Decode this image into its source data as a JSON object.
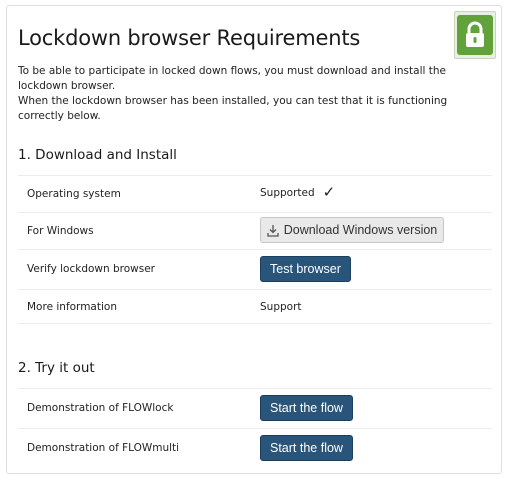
{
  "header": {
    "title": "Lockdown browser Requirements",
    "intro_line1": "To be able to participate in locked down flows, you must download and install the lockdown browser.",
    "intro_line2": "When the lockdown browser has been installed, you can test that it is functioning correctly below.",
    "badge_icon": "lock-icon",
    "badge_color": "#62a23a"
  },
  "download_section": {
    "title": "1. Download and Install",
    "rows": [
      {
        "label": "Operating system",
        "value": "Supported",
        "icon": "checkmark-icon"
      },
      {
        "label": "For Windows",
        "button": "Download Windows version",
        "icon": "download-icon"
      },
      {
        "label": "Verify lockdown browser",
        "button": "Test browser"
      },
      {
        "label": "More information",
        "link": "Support"
      }
    ]
  },
  "try_section": {
    "title": "2. Try it out",
    "rows": [
      {
        "label": "Demonstration of FLOWlock",
        "button": "Start the flow"
      },
      {
        "label": "Demonstration of FLOWmulti",
        "button": "Start the flow"
      }
    ]
  },
  "colors": {
    "primary_button": "#2a557a",
    "secondary_button": "#e9e9e9"
  }
}
